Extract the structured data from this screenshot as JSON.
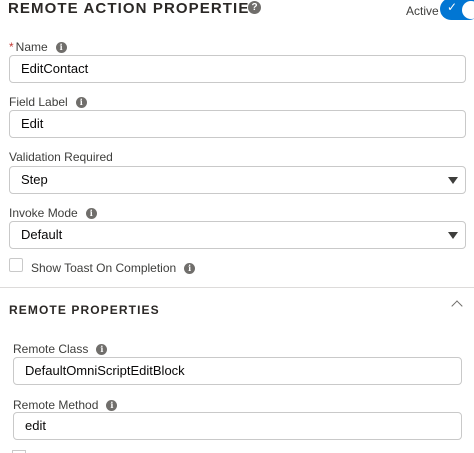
{
  "header": {
    "title": "REMOTE ACTION PROPERTIES",
    "help_glyph": "?",
    "active_label": "Active",
    "active_toggle_on": true
  },
  "fields": {
    "name": {
      "required_mark": "*",
      "label": "Name",
      "value": "EditContact"
    },
    "field_label": {
      "label": "Field Label",
      "value": "Edit"
    },
    "validation_required": {
      "label": "Validation Required",
      "selected": "Step"
    },
    "invoke_mode": {
      "label": "Invoke Mode",
      "selected": "Default"
    },
    "show_toast": {
      "label": "Show Toast On Completion",
      "checked": false
    }
  },
  "remote_section": {
    "title": "REMOTE PROPERTIES",
    "expanded": true,
    "remote_class": {
      "label": "Remote Class",
      "value": "DefaultOmniScriptEditBlock"
    },
    "remote_method": {
      "label": "Remote Method",
      "value": "edit"
    }
  },
  "icons": {
    "info_glyph": "i",
    "help": "question-circle-icon",
    "info": "info-icon",
    "check": "check-icon",
    "chevron_up": "chevron-up-icon",
    "caret_down": "caret-down-icon"
  },
  "colors": {
    "accent": "#0176d3",
    "required": "#c23934",
    "border": "#c9c9c9",
    "icon_gray": "#706e6b"
  }
}
